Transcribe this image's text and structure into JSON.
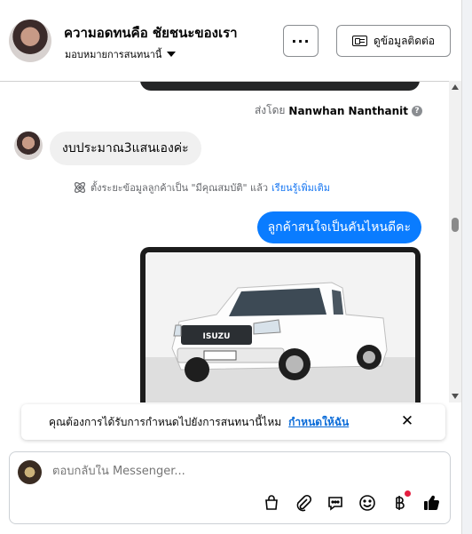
{
  "header": {
    "title": "ความอดทนคือ ชัยชนะของเรา",
    "subtitle": "มอบหมายการสนทนานี้",
    "more_label": "···",
    "contact_label": "ดูข้อมูลติดต่อ"
  },
  "chat": {
    "sent_by_prefix": "ส่งโดย",
    "sent_by_name": "Nanwhan Nanthanit",
    "incoming_message": "งบประมาณ3แสนเองค่ะ",
    "system_note": "ตั้งระยะข้อมูลลูกค้าเป็น \"มีคุณสมบัติ\" แล้ว",
    "system_link": "เรียนรู้เพิ่มเติม",
    "outgoing_message": "ลูกค้าสนใจเป็นคันไหนดีคะ",
    "photo_brand": "ISUZU"
  },
  "banner": {
    "text": "คุณต้องการได้รับการกำหนดไปยังการสนทนานี้ไหม",
    "link": "กำหนดให้ฉัน",
    "close": "✕"
  },
  "composer": {
    "placeholder": "ตอบกลับใน Messenger..."
  },
  "icons": [
    "page-avatar",
    "bag-icon",
    "attachment-icon",
    "saved-reply-icon",
    "emoji-icon",
    "baht-icon",
    "like-icon"
  ],
  "colors": {
    "accent": "#0a7cff",
    "link": "#1877f2",
    "notification": "#e41e3f"
  }
}
